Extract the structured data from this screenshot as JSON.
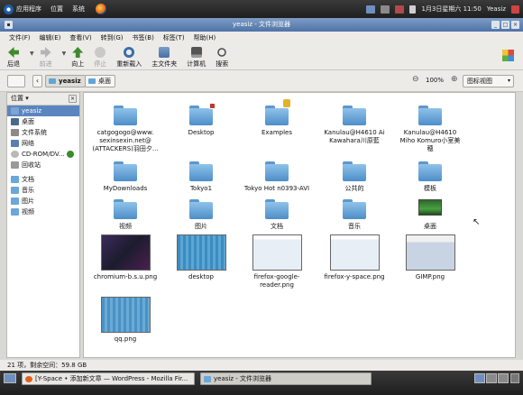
{
  "top_panel": {
    "menus": [
      "应用程序",
      "位置",
      "系统"
    ],
    "clock": "1月3日星期六 11:50",
    "user": "Yeasiz"
  },
  "window": {
    "title": "yeasiz - 文件浏览器"
  },
  "menubar": [
    "文件(F)",
    "编辑(E)",
    "查看(V)",
    "转到(G)",
    "书签(B)",
    "标签(T)",
    "帮助(H)"
  ],
  "toolbar": {
    "back": "后退",
    "forward": "前进",
    "up": "向上",
    "stop": "停止",
    "reload": "重新载入",
    "home": "主文件夹",
    "computer": "计算机",
    "search": "搜索"
  },
  "location": {
    "crumbs": [
      "yeasiz",
      "桌面"
    ],
    "zoom": "100%",
    "view_mode": "图标视图"
  },
  "sidebar": {
    "header": "位置",
    "places": [
      "yeasiz",
      "桌面",
      "文件系统",
      "网络",
      "CD-ROM/DV...",
      "回收站"
    ],
    "bookmarks": [
      "文档",
      "音乐",
      "图片",
      "视频"
    ]
  },
  "items": [
    {
      "label": "catgogogo@www.\nsexinsexin.net@\n(ATTACKERS)羽田夕...",
      "kind": "folder"
    },
    {
      "label": "Desktop",
      "kind": "folder-link"
    },
    {
      "label": "Examples",
      "kind": "folder-locked"
    },
    {
      "label": "Kanulau@H4610 Ai\nKawahara川原藍",
      "kind": "folder"
    },
    {
      "label": "Kanulau@H4610\nMiho Komuro小室美\n穂",
      "kind": "folder"
    },
    {
      "label": "MyDownloads",
      "kind": "folder"
    },
    {
      "label": "Tokyo1",
      "kind": "folder"
    },
    {
      "label": "Tokyo Hot n0393-AVI",
      "kind": "folder"
    },
    {
      "label": "公共的",
      "kind": "folder"
    },
    {
      "label": "模板",
      "kind": "folder"
    },
    {
      "label": "视频",
      "kind": "folder"
    },
    {
      "label": "图片",
      "kind": "folder"
    },
    {
      "label": "文档",
      "kind": "folder"
    },
    {
      "label": "音乐",
      "kind": "folder"
    },
    {
      "label": "桌面",
      "kind": "desktop"
    },
    {
      "label": "chromium-b.s.u.png",
      "kind": "image-chrome"
    },
    {
      "label": "desktop",
      "kind": "image-desktop"
    },
    {
      "label": "firefox-google-\nreader.png",
      "kind": "image-shot"
    },
    {
      "label": "firefox-y-space.png",
      "kind": "image-shot"
    },
    {
      "label": "GIMP.png",
      "kind": "image-gimp"
    },
    {
      "label": "qq.png",
      "kind": "image-qq"
    }
  ],
  "status": "21 项，剩余空间：59.8 GB",
  "taskbar": [
    "[Y-Space • 添加新文章 — WordPress - Mozilla Fir...",
    "yeasiz - 文件浏览器"
  ],
  "colors": {
    "folder": "#6aa7db",
    "selection": "#5b85c0",
    "title": "#5f82b6"
  }
}
